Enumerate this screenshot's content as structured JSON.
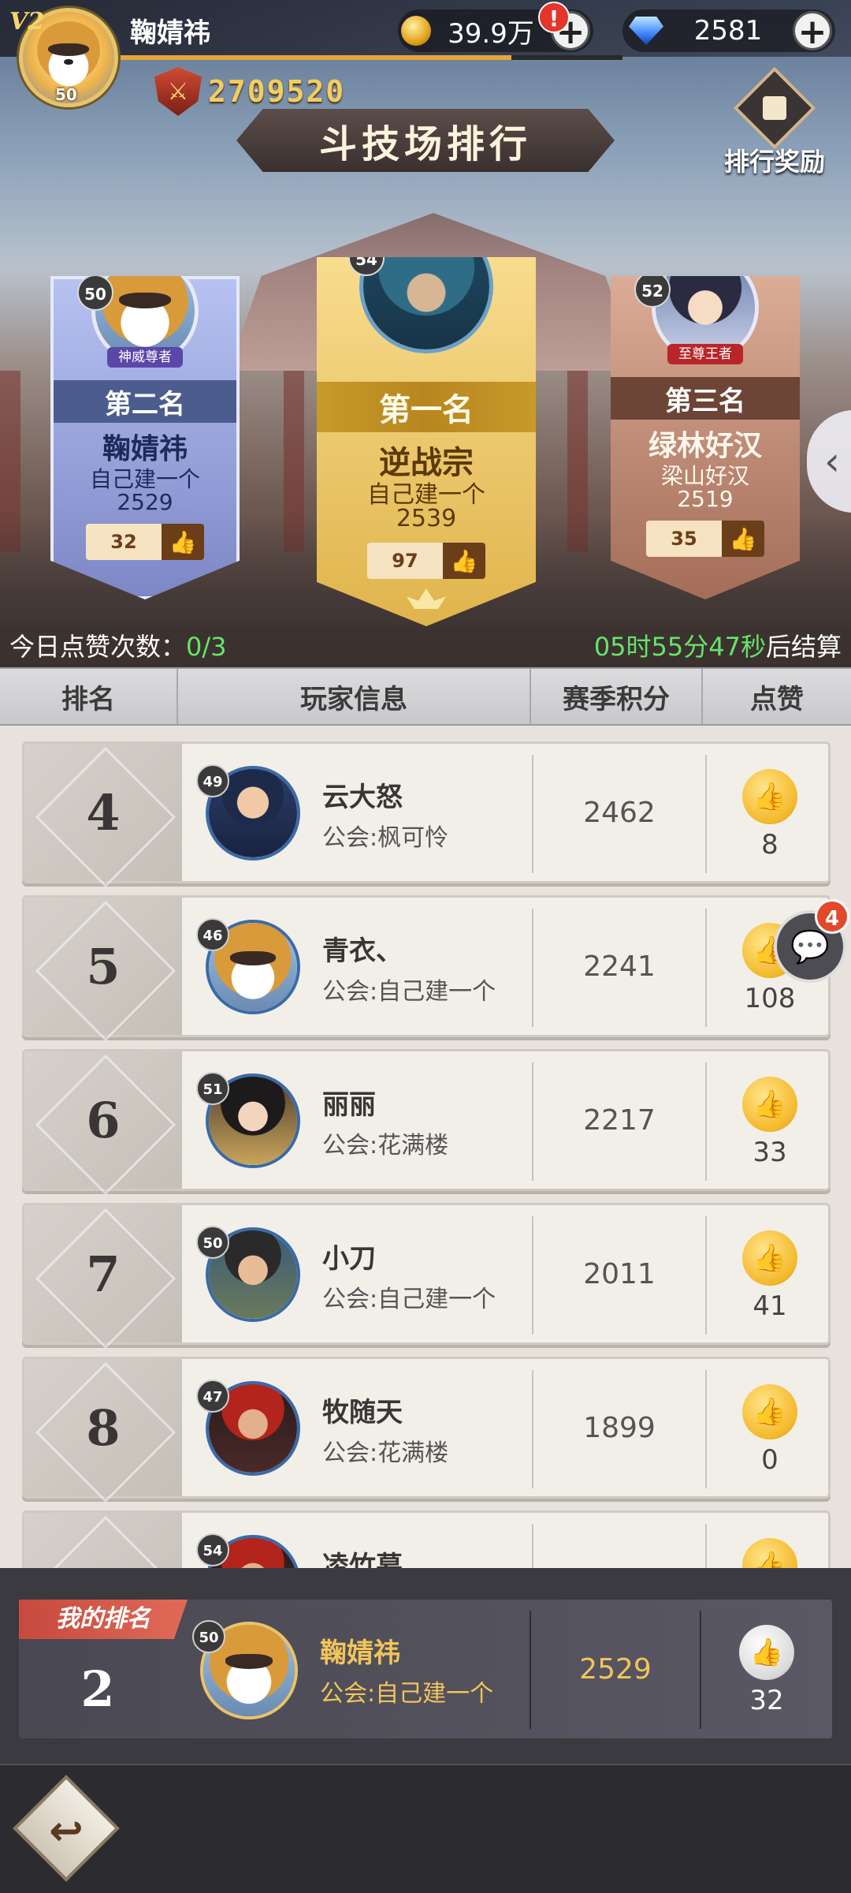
{
  "header": {
    "vip_label": "V2",
    "player_level": "50",
    "player_name": "鞠婧祎",
    "power": "2709520",
    "gold": "39.9万",
    "gems": "2581",
    "alert": "!",
    "plus": "+",
    "xp_progress": 0.78
  },
  "title": "斗技场排行",
  "reward_button_label": "排行奖励",
  "podium": {
    "first": {
      "level": "54",
      "rank_label": "第一名",
      "name": "逆战宗",
      "guild": "自己建一个",
      "score": "2539",
      "likes": "97"
    },
    "second": {
      "level": "50",
      "title_badge": "神威尊者",
      "rank_label": "第二名",
      "name": "鞠婧祎",
      "guild": "自己建一个",
      "score": "2529",
      "likes": "32"
    },
    "third": {
      "level": "52",
      "title_badge": "至尊王者",
      "rank_label": "第三名",
      "name": "绿林好汉",
      "guild": "梁山好汉",
      "score": "2519",
      "likes": "35"
    }
  },
  "info": {
    "likes_today_label": "今日点赞次数：",
    "likes_today_value": "0/3",
    "countdown_time": "05时55分47秒",
    "countdown_suffix": "后结算"
  },
  "table_headers": {
    "rank": "排名",
    "player": "玩家信息",
    "score": "赛季积分",
    "like": "点赞"
  },
  "rows": [
    {
      "rank": "4",
      "level": "49",
      "name": "云大怒",
      "guild": "公会:枫可怜",
      "score": "2462",
      "likes": "8"
    },
    {
      "rank": "5",
      "level": "46",
      "name": "青衣、",
      "guild": "公会:自己建一个",
      "score": "2241",
      "likes": "108"
    },
    {
      "rank": "6",
      "level": "51",
      "name": "丽丽",
      "guild": "公会:花满楼",
      "score": "2217",
      "likes": "33"
    },
    {
      "rank": "7",
      "level": "50",
      "name": "小刀",
      "guild": "公会:自己建一个",
      "score": "2011",
      "likes": "41"
    },
    {
      "rank": "8",
      "level": "47",
      "name": "牧随天",
      "guild": "公会:花满楼",
      "score": "1899",
      "likes": "0"
    },
    {
      "rank": "",
      "level": "54",
      "name": "凌竹幕",
      "guild": "",
      "score": "",
      "likes": ""
    }
  ],
  "chat": {
    "badge": "4"
  },
  "my_rank": {
    "tag": "我的排名",
    "rank": "2",
    "level": "50",
    "name": "鞠婧祎",
    "guild": "公会:自己建一个",
    "score": "2529",
    "likes": "32"
  },
  "icons": {
    "like": "thumbs-up-icon",
    "back": "return-arrow-icon",
    "chat": "chat-bubble-icon",
    "gift": "gift-icon",
    "arrow": "chevron-left-icon"
  }
}
